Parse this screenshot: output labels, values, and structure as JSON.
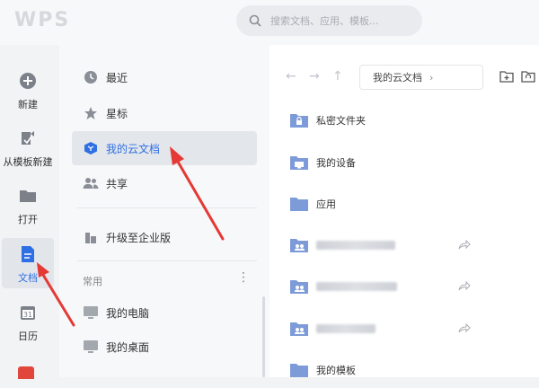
{
  "app": {
    "logo": "WPS"
  },
  "search": {
    "placeholder": "搜索文档、应用、模板..."
  },
  "leftnav": {
    "items": [
      {
        "label": "新建",
        "icon": "plus-circle-icon"
      },
      {
        "label": "从模板新建",
        "icon": "template-icon"
      },
      {
        "label": "打开",
        "icon": "folder-icon"
      },
      {
        "label": "文档",
        "icon": "document-icon",
        "active": true
      },
      {
        "label": "日历",
        "icon": "calendar-icon"
      }
    ]
  },
  "tree": {
    "items": [
      {
        "label": "最近",
        "icon": "clock-icon"
      },
      {
        "label": "星标",
        "icon": "star-icon"
      },
      {
        "label": "我的云文档",
        "icon": "cloud-doc-icon",
        "active": true
      },
      {
        "label": "共享",
        "icon": "share-users-icon"
      },
      {
        "label": "升级至企业版",
        "icon": "enterprise-icon"
      }
    ],
    "section_label": "常用",
    "common": [
      {
        "label": "我的电脑",
        "icon": "computer-icon"
      },
      {
        "label": "我的桌面",
        "icon": "desktop-icon"
      }
    ]
  },
  "main": {
    "breadcrumb": "我的云文档",
    "files": [
      {
        "name": "私密文件夹",
        "icon": "private-folder-icon"
      },
      {
        "name": "我的设备",
        "icon": "device-folder-icon"
      },
      {
        "name": "应用",
        "icon": "folder-icon"
      },
      {
        "name": "",
        "icon": "shared-folder-icon",
        "shared": true,
        "blurred": true
      },
      {
        "name": "",
        "icon": "shared-folder-icon",
        "shared": true,
        "blurred": true
      },
      {
        "name": "",
        "icon": "shared-folder-icon",
        "shared": true,
        "blurred": true
      },
      {
        "name": "我的模板",
        "icon": "folder-icon"
      }
    ]
  },
  "colors": {
    "accent": "#2f6fe4",
    "folder": "#7d9bd9",
    "annotation": "#e53935"
  }
}
